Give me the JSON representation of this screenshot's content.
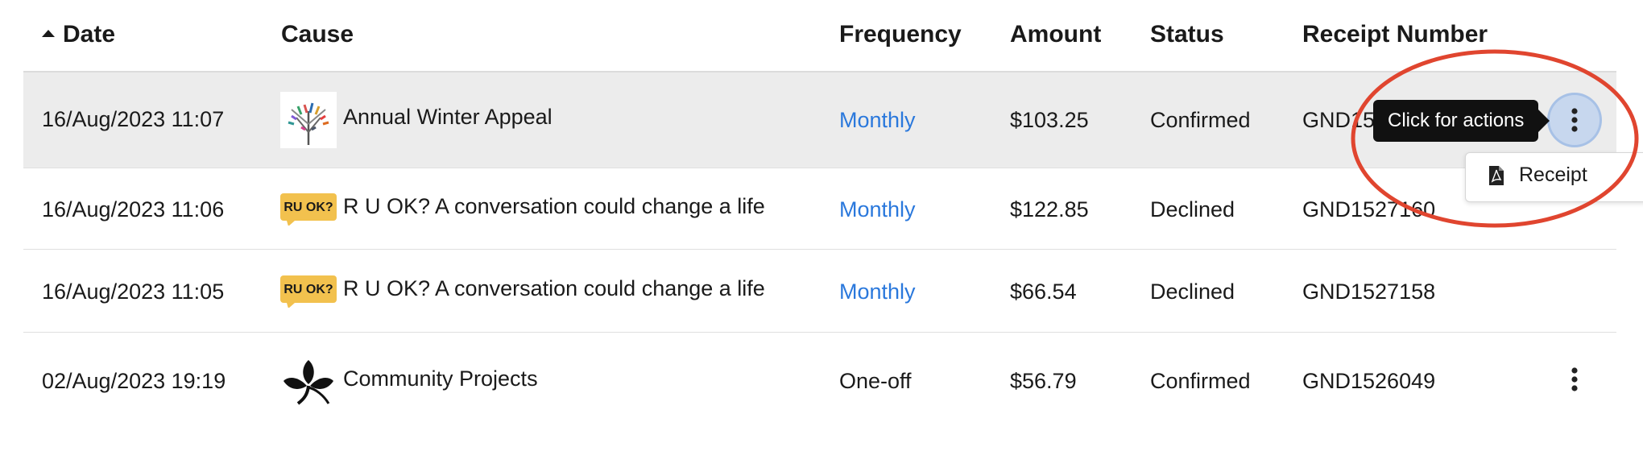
{
  "table": {
    "headers": {
      "date": "Date",
      "cause": "Cause",
      "frequency": "Frequency",
      "amount": "Amount",
      "status": "Status",
      "receipt_number": "Receipt Number"
    },
    "sort": {
      "column": "date",
      "direction": "ascending",
      "icon": "sort-up-triangle-icon"
    },
    "rows": [
      {
        "date": "16/Aug/2023 11:07",
        "logo": "tree-logo-icon",
        "cause": "Annual Winter Appeal",
        "frequency": "Monthly",
        "frequency_is_link": true,
        "amount": "$103.25",
        "status": "Confirmed",
        "receipt_number": "GND15",
        "highlighted": true
      },
      {
        "date": "16/Aug/2023 11:06",
        "logo": "ruok-logo-icon",
        "logo_text": "RU OK?",
        "cause": "R U OK? A conversation could change a life",
        "frequency": "Monthly",
        "frequency_is_link": true,
        "amount": "$122.85",
        "status": "Declined",
        "receipt_number": "GND1527160"
      },
      {
        "date": "16/Aug/2023 11:05",
        "logo": "ruok-logo-icon",
        "logo_text": "RU OK?",
        "cause": "R U OK? A conversation could change a life",
        "frequency": "Monthly",
        "frequency_is_link": true,
        "amount": "$66.54",
        "status": "Declined",
        "receipt_number": "GND1527158"
      },
      {
        "date": "02/Aug/2023 19:19",
        "logo": "leaf-logo-icon",
        "cause": "Community Projects",
        "frequency": "One-off",
        "frequency_is_link": false,
        "amount": "$56.79",
        "status": "Confirmed",
        "receipt_number": "GND1526049"
      }
    ]
  },
  "tooltip": {
    "text": "Click for actions"
  },
  "actions_menu": {
    "items": [
      {
        "label": "Receipt",
        "icon": "pdf-file-icon"
      }
    ]
  },
  "colors": {
    "link": "#2a78dc",
    "row_highlight": "#ececec",
    "annotation": "#e0452f",
    "ruok_yellow": "#f2c14e"
  }
}
